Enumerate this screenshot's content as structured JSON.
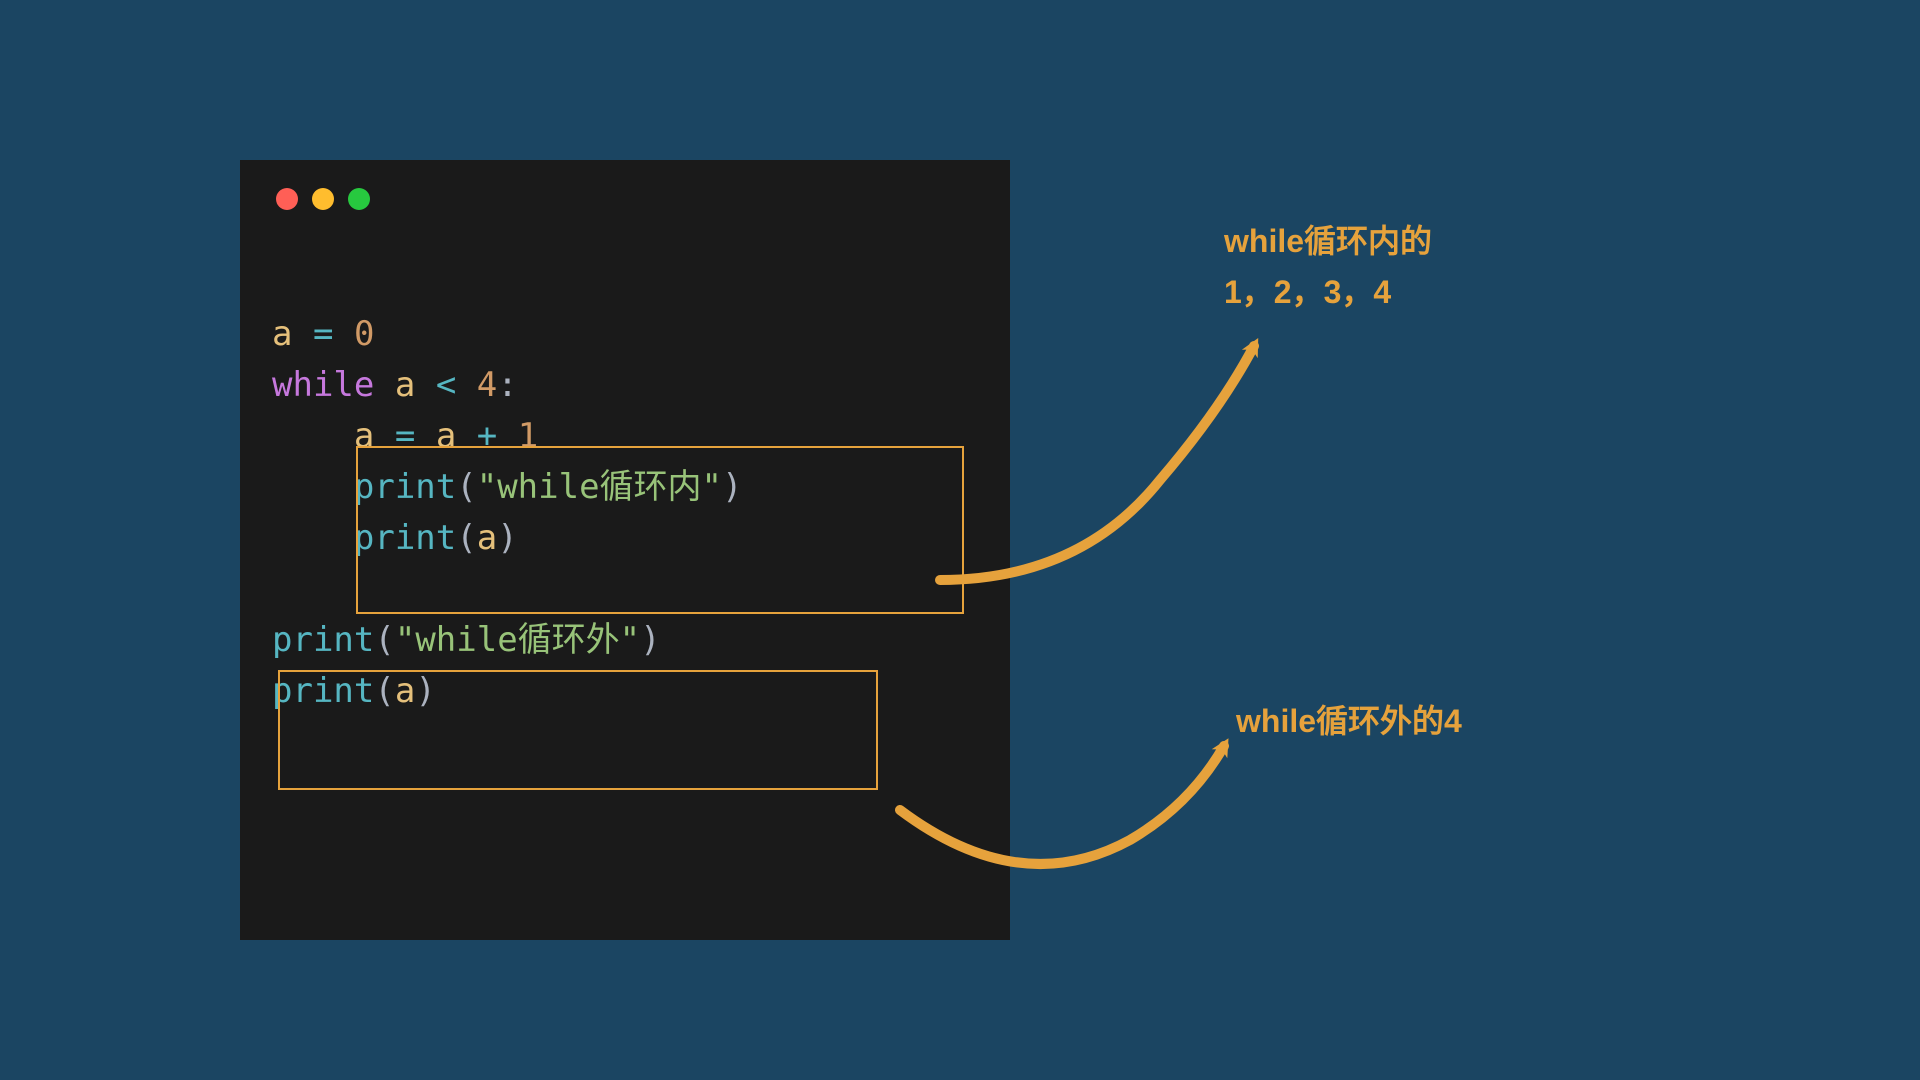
{
  "window": {
    "traffic_lights": [
      "red",
      "yellow",
      "green"
    ]
  },
  "code": {
    "line1": {
      "var": "a",
      "op": "=",
      "num": "0"
    },
    "line2": {
      "kw": "while",
      "var": "a",
      "op": "<",
      "num": "4",
      "punc": ":"
    },
    "line3": {
      "var1": "a",
      "op1": "=",
      "var2": "a",
      "op2": "+",
      "num": "1"
    },
    "line4": {
      "fn": "print",
      "open": "(",
      "str": "\"while循环内\"",
      "close": ")"
    },
    "line5": {
      "fn": "print",
      "open": "(",
      "var": "a",
      "close": ")"
    },
    "line6_blank": "",
    "line7": {
      "fn": "print",
      "open": "(",
      "str": "\"while循环外\"",
      "close": ")"
    },
    "line8": {
      "fn": "print",
      "open": "(",
      "var": "a",
      "close": ")"
    }
  },
  "annotations": {
    "inner_loop_line1": "while循环内的",
    "inner_loop_line2": "1，2，3，4",
    "outer_loop": "while循环外的4"
  },
  "colors": {
    "background": "#1b4562",
    "code_bg": "#1a1a1a",
    "highlight": "#e6a23c",
    "arrow": "#e6a23c"
  }
}
